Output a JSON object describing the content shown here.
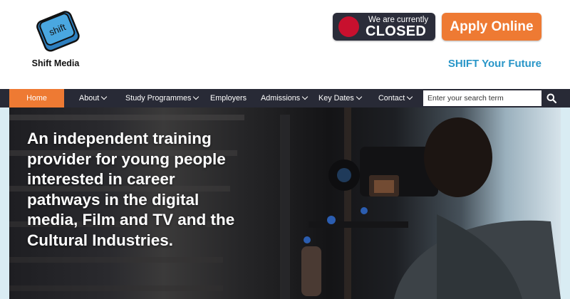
{
  "brand": {
    "name": "Shift Media",
    "logo_key_text": "shift",
    "logo_color": "#4aa7e0"
  },
  "status": {
    "line1": "We are currently",
    "line2": "CLOSED",
    "dot_color": "#c8102e"
  },
  "apply": {
    "label": "Apply Online",
    "color": "#ee7a33"
  },
  "tagline": "SHIFT Your Future",
  "nav": {
    "items": [
      {
        "label": "Home",
        "active": true
      },
      {
        "label": "About",
        "dropdown": true
      },
      {
        "label": "Study Programmes",
        "dropdown": true
      },
      {
        "label": "Employers"
      },
      {
        "label": "Admissions",
        "dropdown": true
      },
      {
        "label": "Key Dates",
        "dropdown": true
      },
      {
        "label": "Contact",
        "dropdown": true
      }
    ],
    "search": {
      "placeholder": "Enter your search term",
      "icon": "search-icon"
    }
  },
  "hero": {
    "headline": "An independent training provider for young people interested in career pathways in the digital media, Film and TV and the Cultural Industries."
  }
}
